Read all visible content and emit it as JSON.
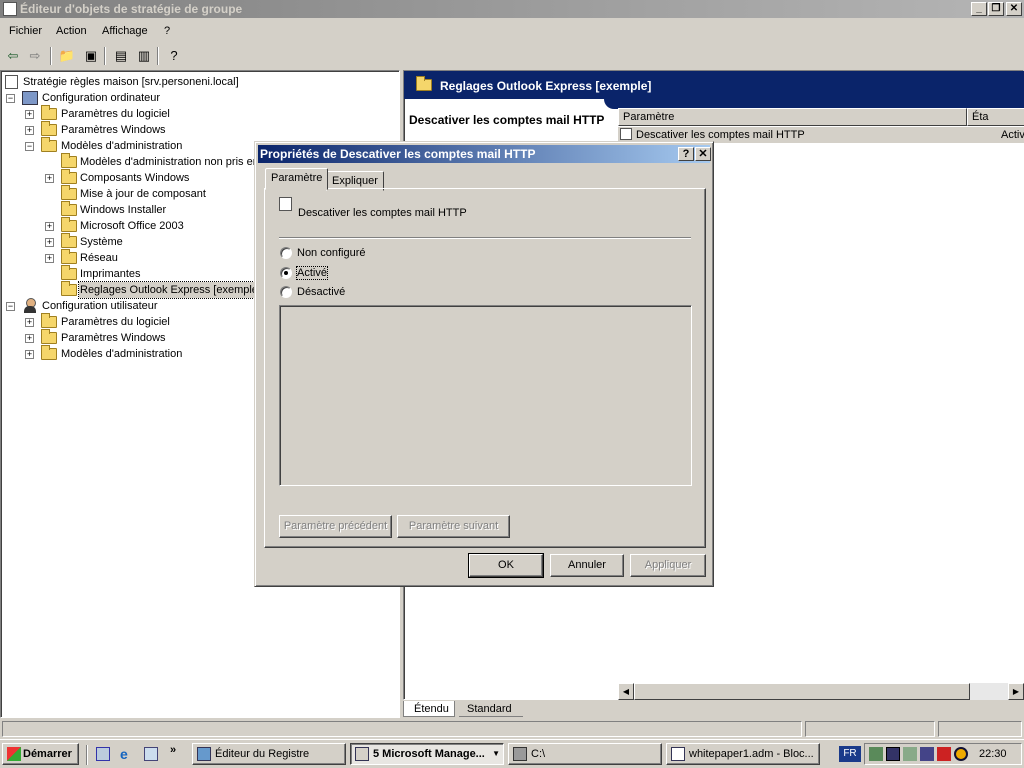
{
  "window": {
    "title": "Éditeur d'objets de stratégie de groupe"
  },
  "menu": [
    "Fichier",
    "Action",
    "Affichage",
    "?"
  ],
  "tree": {
    "root": "Stratégie règles maison [srv.personeni.local]",
    "computer_config": "Configuration ordinateur",
    "computer_items": [
      "Paramètres du logiciel",
      "Paramètres Windows",
      "Modèles d'administration"
    ],
    "admin_items": [
      "Modèles d'administration non pris en",
      "Composants Windows",
      "Mise à jour de composant",
      "Windows Installer",
      "Microsoft Office 2003",
      "Système",
      "Réseau",
      "Imprimantes",
      "Reglages Outlook Express [exemple]"
    ],
    "user_config": "Configuration utilisateur",
    "user_items": [
      "Paramètres du logiciel",
      "Paramètres Windows",
      "Modèles d'administration"
    ]
  },
  "right_pane": {
    "header": "Reglages Outlook Express [exemple]",
    "description_title": "Descativer les comptes mail HTTP",
    "columns": [
      "Paramètre",
      "Éta"
    ],
    "rows": [
      {
        "name": "Descativer les comptes mail HTTP",
        "state": "Activ"
      }
    ]
  },
  "view_tabs": [
    "Étendu",
    "Standard"
  ],
  "dialog": {
    "title": "Propriétés de Descativer les comptes mail HTTP",
    "help_btn": "?",
    "close_btn": "✕",
    "tabs": [
      "Paramètre",
      "Expliquer"
    ],
    "policy_name": "Descativer les comptes mail HTTP",
    "options": [
      "Non configuré",
      "Activé",
      "Désactivé"
    ],
    "selected_option": "Activé",
    "prev_button": "Paramètre précédent",
    "next_button": "Paramètre suivant",
    "ok": "OK",
    "cancel": "Annuler",
    "apply": "Appliquer"
  },
  "taskbar": {
    "start": "Démarrer",
    "tasks": [
      "Éditeur du Registre",
      "5 Microsoft Manage...",
      "C:\\",
      "whitepaper1.adm - Bloc..."
    ],
    "lang": "FR",
    "clock": "22:30"
  }
}
